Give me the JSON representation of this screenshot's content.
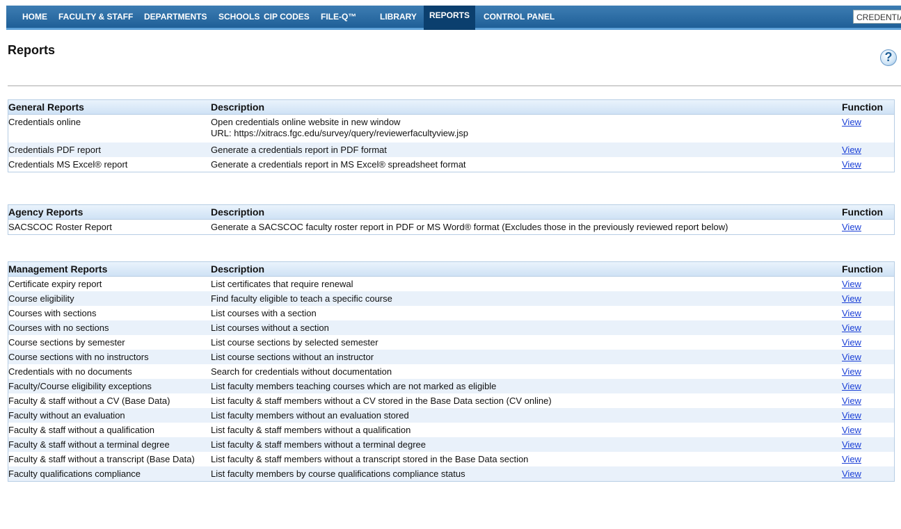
{
  "nav": {
    "items": [
      {
        "label": "HOME",
        "active": false
      },
      {
        "label": "FACULTY & STAFF",
        "active": false
      },
      {
        "label": "DEPARTMENTS",
        "active": false
      },
      {
        "label": "SCHOOLS",
        "active": false
      },
      {
        "label": "CIP CODES",
        "active": false
      },
      {
        "label": "FILE-Q™",
        "active": false
      },
      {
        "label": "LIBRARY",
        "active": false
      },
      {
        "label": "REPORTS",
        "active": true
      },
      {
        "label": "CONTROL PANEL",
        "active": false
      }
    ],
    "search_value": "CREDENTIALS"
  },
  "page": {
    "title": "Reports",
    "help_icon": "question-mark-icon"
  },
  "general": {
    "col1": "General Reports",
    "col2": "Description",
    "col3": "Function",
    "rows": [
      {
        "name": "Credentials online",
        "desc": "Open credentials online website in new window",
        "desc2": "URL: https://xitracs.fgc.edu/survey/query/reviewerfacultyview.jsp",
        "fn": "View"
      },
      {
        "name": "Credentials PDF report",
        "desc": "Generate a credentials report in PDF format",
        "fn": "View"
      },
      {
        "name": "Credentials MS Excel® report",
        "desc": "Generate a credentials report in MS Excel® spreadsheet format",
        "fn": "View"
      }
    ]
  },
  "agency": {
    "col1": "Agency Reports",
    "col2": "Description",
    "col3": "Function",
    "rows": [
      {
        "name": "SACSCOC Roster Report",
        "desc": "Generate a SACSCOC faculty roster report in PDF or MS Word® format (Excludes those in the previously reviewed report below)",
        "fn": "View"
      }
    ]
  },
  "management": {
    "col1": "Management Reports",
    "col2": "Description",
    "col3": "Function",
    "rows": [
      {
        "name": "Certificate expiry report",
        "desc": "List certificates that require renewal",
        "fn": "View"
      },
      {
        "name": "Course eligibility",
        "desc": "Find faculty eligible to teach a specific course",
        "fn": "View"
      },
      {
        "name": "Courses with sections",
        "desc": "List courses with a section",
        "fn": "View"
      },
      {
        "name": "Courses with no sections",
        "desc": "List courses without a section",
        "fn": "View"
      },
      {
        "name": "Course sections by semester",
        "desc": "List course sections by selected semester",
        "fn": "View"
      },
      {
        "name": "Course sections with no instructors",
        "desc": "List course sections without an instructor",
        "fn": "View"
      },
      {
        "name": "Credentials with no documents",
        "desc": "Search for credentials without documentation",
        "fn": "View"
      },
      {
        "name": "Faculty/Course eligibility exceptions",
        "desc": "List faculty members teaching courses which are not marked as eligible",
        "fn": "View"
      },
      {
        "name": "Faculty & staff without a CV (Base Data)",
        "desc": "List faculty & staff members without a CV stored in the Base Data section (CV online)",
        "fn": "View"
      },
      {
        "name": "Faculty without an evaluation",
        "desc": "List faculty members without an evaluation stored",
        "fn": "View"
      },
      {
        "name": "Faculty & staff without a qualification",
        "desc": "List faculty & staff members without a qualification",
        "fn": "View"
      },
      {
        "name": "Faculty & staff without a terminal degree",
        "desc": "List faculty & staff members without a terminal degree",
        "fn": "View"
      },
      {
        "name": "Faculty & staff without a transcript (Base Data)",
        "desc": "List faculty & staff members without a transcript stored in the Base Data section",
        "fn": "View"
      },
      {
        "name": "Faculty qualifications compliance",
        "desc": "List faculty members by course qualifications compliance status",
        "fn": "View"
      }
    ]
  }
}
